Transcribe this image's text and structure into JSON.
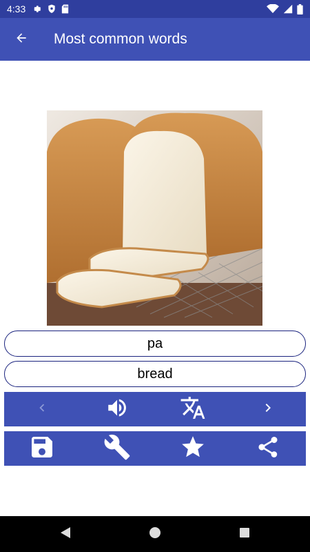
{
  "status_bar": {
    "time": "4:33",
    "left_icons": [
      "gear-icon",
      "shield-icon",
      "sd-card-icon"
    ],
    "right_icons": [
      "wifi-icon",
      "signal-icon",
      "battery-icon"
    ]
  },
  "app_bar": {
    "title": "Most common words",
    "back_icon": "arrow-back-icon"
  },
  "image": {
    "subject": "bread-photo"
  },
  "word": {
    "native": "pa",
    "english": "bread"
  },
  "nav_toolbar": {
    "items": [
      "chevron-left-icon",
      "volume-icon",
      "translate-icon",
      "chevron-right-icon"
    ]
  },
  "action_toolbar": {
    "items": [
      "save-icon",
      "wrench-icon",
      "star-icon",
      "share-icon"
    ]
  },
  "system_nav": {
    "items": [
      "back-triangle-icon",
      "home-circle-icon",
      "recents-square-icon"
    ]
  },
  "colors": {
    "primary": "#3f51b5",
    "primary_dark": "#2f3e9e",
    "pill_border": "#1a237e",
    "disabled_icon": "#8c99d6"
  }
}
